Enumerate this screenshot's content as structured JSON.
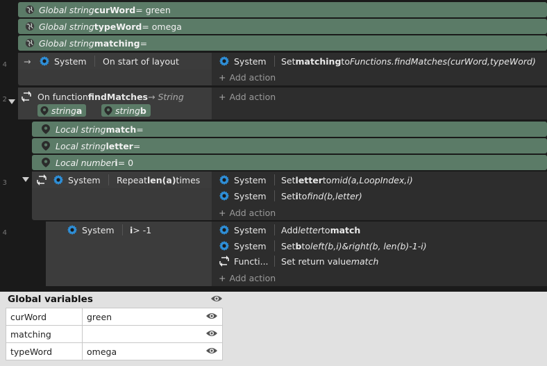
{
  "global_var_rows": [
    {
      "prefix": "Global string ",
      "name": "curWord",
      "suffix": " = green"
    },
    {
      "prefix": "Global string ",
      "name": "typeWord",
      "suffix": " = omega"
    },
    {
      "prefix": "Global string ",
      "name": "matching",
      "suffix": " ="
    }
  ],
  "event4": {
    "line": "4",
    "arrow": "→",
    "object": "System",
    "condition": "On start of layout",
    "action": {
      "object": "System",
      "pre": "Set ",
      "bold": "matching",
      "mid": " to ",
      "italic": "Functions.findMatches(curWord,typeWord)"
    },
    "add_action": "Add action"
  },
  "event2": {
    "line": "2",
    "pre": "On function ",
    "name": "findMatches",
    "ret": " → String",
    "params": [
      {
        "type": "string ",
        "name": "a"
      },
      {
        "type": "string ",
        "name": "b"
      }
    ],
    "add_action": "Add action"
  },
  "locals": [
    {
      "prefix": "Local string ",
      "name": "match",
      "suffix": " ="
    },
    {
      "prefix": "Local string ",
      "name": "letter",
      "suffix": " ="
    },
    {
      "prefix": "Local number ",
      "name": "i",
      "suffix": " = 0"
    }
  ],
  "event3": {
    "line": "3",
    "object": "System",
    "cond_pre": "Repeat ",
    "cond_bold": "len(a)",
    "cond_post": " times",
    "actions": [
      {
        "object": "System",
        "pre": "Set ",
        "bold": "letter",
        "mid": " to ",
        "italic": "mid(a,LoopIndex,i)"
      },
      {
        "object": "System",
        "pre": "Set ",
        "bold": "i",
        "mid": " to ",
        "italic": "find(b,letter)"
      }
    ],
    "add_action": "Add action"
  },
  "event4b": {
    "line": "4",
    "object": "System",
    "cond_bold": "i",
    "cond_post": " > -1",
    "actions": [
      {
        "object": "System",
        "text_a": "Add ",
        "italic_a": "letter",
        "text_b": " to ",
        "bold_b": "match"
      },
      {
        "object": "System",
        "text_a": "Set ",
        "bold_a": "b",
        "text_b": " to ",
        "italic_b": "left(b,i)&right(b, len(b)-1-i)"
      },
      {
        "object": "Functi...",
        "text_a": "Set return value ",
        "italic_a": "match"
      }
    ],
    "add_action": "Add action"
  },
  "panel": {
    "title": "Global variables",
    "rows": [
      {
        "name": "curWord",
        "value": "green"
      },
      {
        "name": "matching",
        "value": ""
      },
      {
        "name": "typeWord",
        "value": "omega"
      }
    ]
  },
  "icons": {
    "globe": "globe-icon",
    "gear": "gear-icon",
    "pin": "pin-icon",
    "loop": "loop-icon",
    "function": "function-icon",
    "eye": "eye-icon"
  },
  "colors": {
    "variable_bg": "#5b7b67",
    "gear_blue": "#2e8fd8",
    "sheet_bg": "#1a1a1a",
    "panel_bg": "#e1e1e1"
  }
}
